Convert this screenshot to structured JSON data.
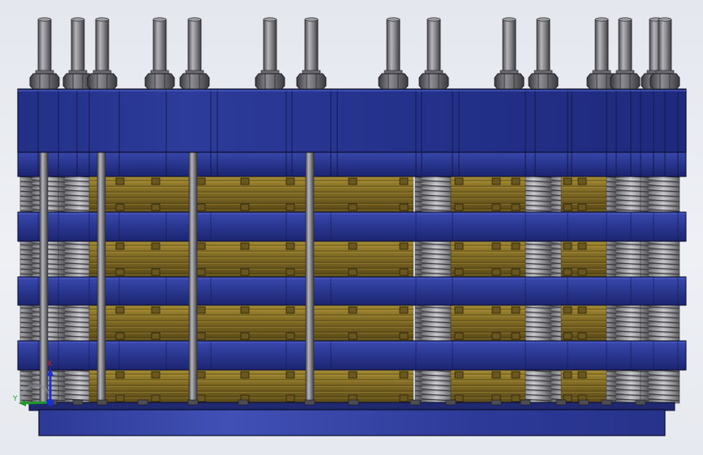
{
  "viewport": {
    "name": "3d-cad-viewport"
  },
  "model": {
    "name": "stacked-plate-spring-assembly",
    "colors": {
      "plate": "#25318a",
      "plate_light": "#3a49b0",
      "plate_dark": "#141c5e",
      "brass": "#7a6522",
      "brass_light": "#a0882f",
      "steel": "#7f7f83",
      "steel_light": "#b4b4b8",
      "nut": "#5d5d62",
      "outline": "#0a0e2a"
    }
  },
  "triad": {
    "x_label": "X",
    "y_label": "Y",
    "z_label": "Z",
    "x_color": "#d4202a",
    "y_color": "#1f9a2a",
    "z_color": "#1c2fd0"
  }
}
